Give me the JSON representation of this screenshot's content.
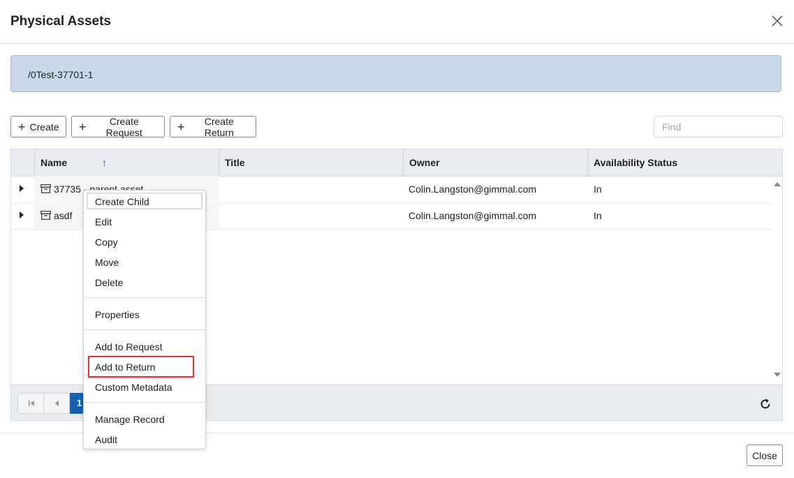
{
  "dialog": {
    "title": "Physical Assets",
    "close_label": "Close"
  },
  "path": "/0Test-37701-1",
  "toolbar": {
    "create": "Create",
    "create_request": "Create Request",
    "create_return": "Create Return",
    "find_placeholder": "Find"
  },
  "grid": {
    "columns": {
      "name": "Name",
      "title": "Title",
      "owner": "Owner",
      "status": "Availability Status"
    },
    "sort_indicator": "↑",
    "rows": [
      {
        "name": "37735 - parent asset",
        "title": "",
        "owner": "Colin.Langston@gimmal.com",
        "status": "In"
      },
      {
        "name": "asdf",
        "title": "",
        "owner": "Colin.Langston@gimmal.com",
        "status": "In"
      }
    ],
    "current_page": "1"
  },
  "context_menu": {
    "items": [
      "Create Child",
      "Edit",
      "Copy",
      "Move",
      "Delete",
      "Properties",
      "Add to Request",
      "Add to Return",
      "Custom Metadata",
      "Manage Record",
      "Audit"
    ],
    "highlighted": "Add to Return"
  },
  "colors": {
    "path_bar": "#c9d9ea",
    "accent": "#1461b0",
    "highlight": "#e0353a"
  }
}
